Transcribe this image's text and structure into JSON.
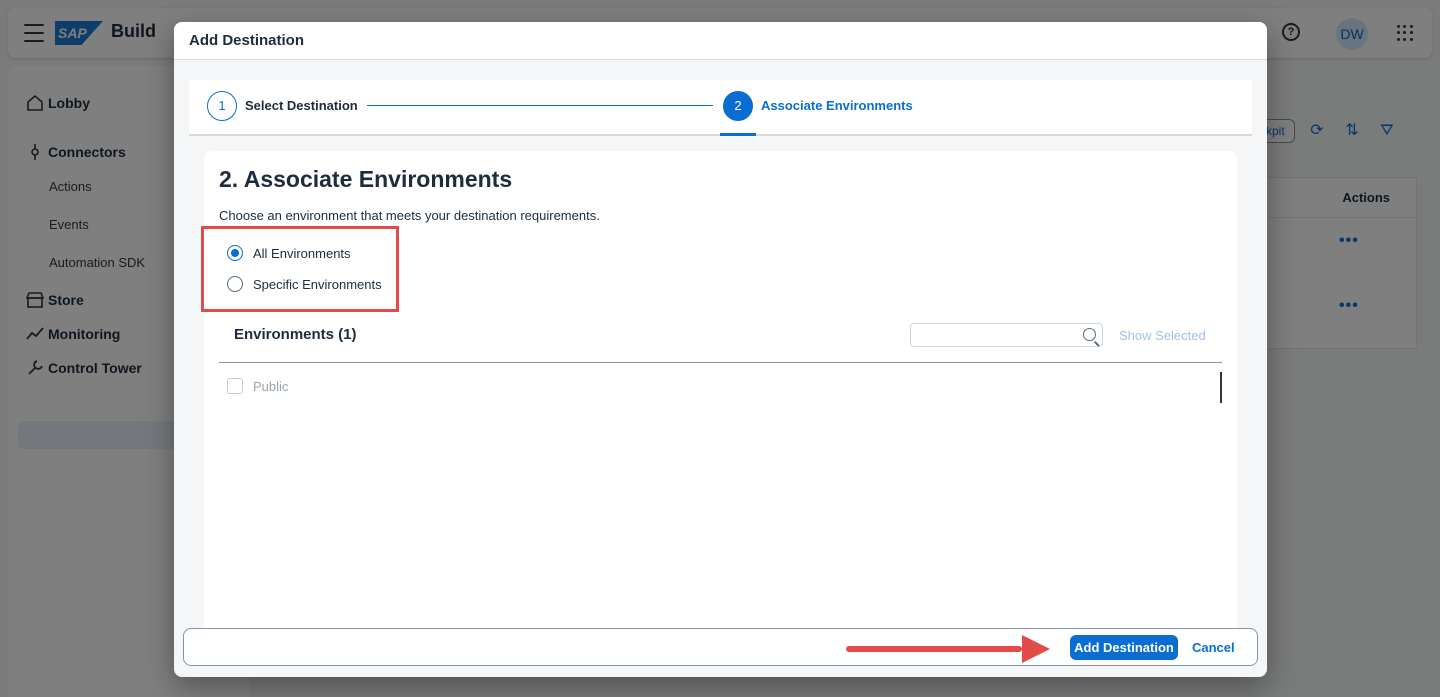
{
  "app": {
    "logo_text": "SAP",
    "product": "Build",
    "avatar_initials": "DW",
    "help_glyph": "?"
  },
  "sidebar": {
    "items": [
      {
        "label": "Lobby",
        "icon": "home-icon"
      },
      {
        "label": "Connectors",
        "icon": "connector-icon"
      },
      {
        "label": "Actions"
      },
      {
        "label": "Events"
      },
      {
        "label": "Automation SDK"
      },
      {
        "label": "Store",
        "icon": "store-icon"
      },
      {
        "label": "Monitoring",
        "icon": "monitoring-icon"
      },
      {
        "label": "Control Tower",
        "icon": "wrench-icon"
      }
    ]
  },
  "background": {
    "toolbar_button_partial": "kpit",
    "table_header": "Actions",
    "row_menu": "•••"
  },
  "dialog": {
    "title": "Add Destination",
    "steps": [
      {
        "number": "1",
        "label": "Select Destination"
      },
      {
        "number": "2",
        "label": "Associate Environments"
      }
    ],
    "section_title": "2. Associate Environments",
    "section_desc": "Choose an environment that meets your destination requirements.",
    "options": [
      {
        "label": "All Environments",
        "checked": true
      },
      {
        "label": "Specific Environments",
        "checked": false
      }
    ],
    "environments_title": "Environments (1)",
    "search_placeholder": "",
    "show_selected_label": "Show Selected",
    "environments": [
      {
        "label": "Public"
      }
    ],
    "footer": {
      "primary_label": "Add Destination",
      "cancel_label": "Cancel"
    }
  },
  "colors": {
    "accent": "#0a6ed1",
    "annotation": "#e34b4b"
  }
}
